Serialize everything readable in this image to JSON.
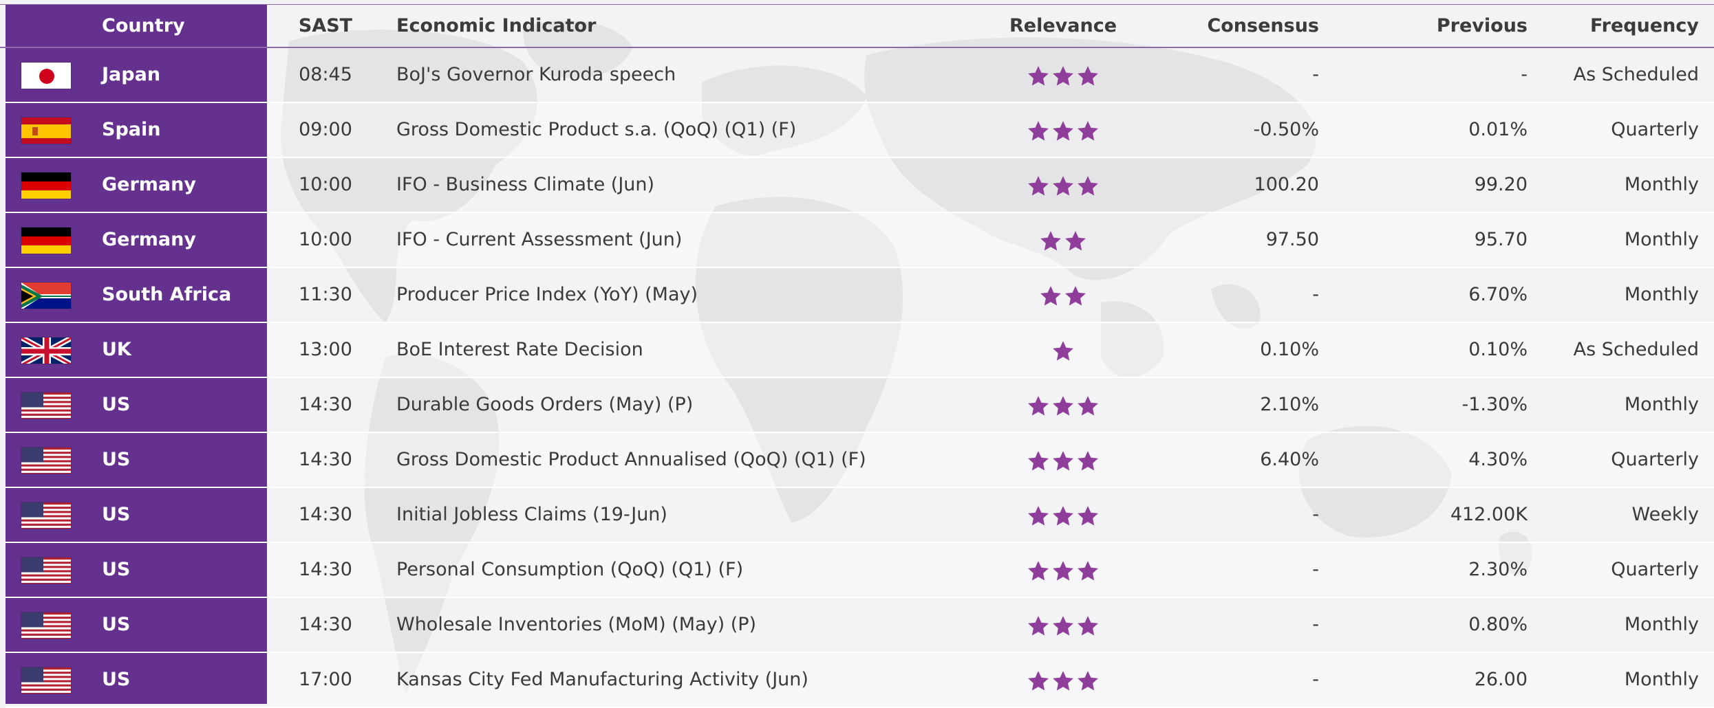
{
  "colors": {
    "country_column": "#64318f",
    "star": "#8e3d9b",
    "text": "#3a3a3a"
  },
  "headers": {
    "country": "Country",
    "time": "SAST",
    "indicator": "Economic Indicator",
    "relevance": "Relevance",
    "consensus": "Consensus",
    "previous": "Previous",
    "frequency": "Frequency"
  },
  "rows": [
    {
      "flag": "japan-flag-icon",
      "country": "Japan",
      "time": "08:45",
      "indicator": "BoJ's Governor Kuroda speech",
      "relevance": 3,
      "consensus": "-",
      "previous": "-",
      "frequency": "As Scheduled"
    },
    {
      "flag": "spain-flag-icon",
      "country": "Spain",
      "time": "09:00",
      "indicator": "Gross Domestic Product  s.a. (QoQ) (Q1) (F)",
      "relevance": 3,
      "consensus": "-0.50%",
      "previous": "0.01%",
      "frequency": "Quarterly"
    },
    {
      "flag": "germany-flag-icon",
      "country": "Germany",
      "time": "10:00",
      "indicator": "IFO - Business Climate (Jun)",
      "relevance": 3,
      "consensus": "100.20",
      "previous": "99.20",
      "frequency": "Monthly"
    },
    {
      "flag": "germany-flag-icon",
      "country": "Germany",
      "time": "10:00",
      "indicator": "IFO - Current Assessment (Jun)",
      "relevance": 2,
      "consensus": "97.50",
      "previous": "95.70",
      "frequency": "Monthly"
    },
    {
      "flag": "south-africa-flag-icon",
      "country": "South Africa",
      "time": "11:30",
      "indicator": "Producer Price Index (YoY) (May)",
      "relevance": 2,
      "consensus": "-",
      "previous": "6.70%",
      "frequency": "Monthly"
    },
    {
      "flag": "uk-flag-icon",
      "country": "UK",
      "time": "13:00",
      "indicator": "BoE Interest Rate Decision",
      "relevance": 1,
      "consensus": "0.10%",
      "previous": "0.10%",
      "frequency": "As Scheduled"
    },
    {
      "flag": "us-flag-icon",
      "country": "US",
      "time": "14:30",
      "indicator": "Durable Goods Orders (May) (P)",
      "relevance": 3,
      "consensus": "2.10%",
      "previous": "-1.30%",
      "frequency": "Monthly"
    },
    {
      "flag": "us-flag-icon",
      "country": "US",
      "time": "14:30",
      "indicator": "Gross Domestic Product Annualised (QoQ) (Q1) (F)",
      "relevance": 3,
      "consensus": "6.40%",
      "previous": "4.30%",
      "frequency": "Quarterly"
    },
    {
      "flag": "us-flag-icon",
      "country": "US",
      "time": "14:30",
      "indicator": "Initial Jobless Claims (19-Jun)",
      "relevance": 3,
      "consensus": "-",
      "previous": "412.00K",
      "frequency": "Weekly"
    },
    {
      "flag": "us-flag-icon",
      "country": "US",
      "time": "14:30",
      "indicator": "Personal Consumption (QoQ) (Q1) (F)",
      "relevance": 3,
      "consensus": "-",
      "previous": "2.30%",
      "frequency": "Quarterly"
    },
    {
      "flag": "us-flag-icon",
      "country": "US",
      "time": "14:30",
      "indicator": "Wholesale Inventories (MoM) (May) (P)",
      "relevance": 3,
      "consensus": "-",
      "previous": "0.80%",
      "frequency": "Monthly"
    },
    {
      "flag": "us-flag-icon",
      "country": "US",
      "time": "17:00",
      "indicator": "Kansas City Fed Manufacturing Activity (Jun)",
      "relevance": 3,
      "consensus": "-",
      "previous": "26.00",
      "frequency": "Monthly"
    }
  ]
}
